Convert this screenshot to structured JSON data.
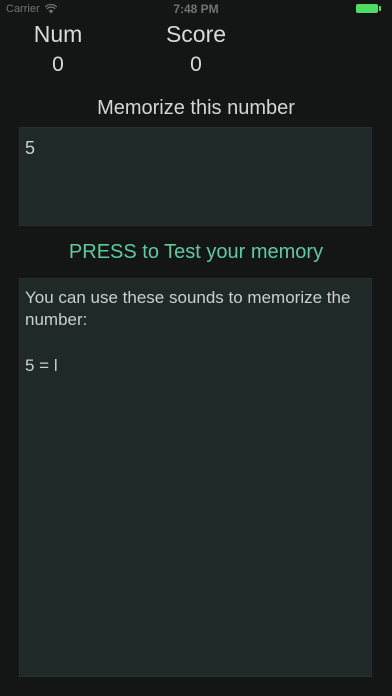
{
  "status_bar": {
    "carrier": "Carrier",
    "time": "7:48 PM",
    "battery_color": "#4fdc64"
  },
  "stats": {
    "num_label": "Num",
    "num_value": "0",
    "score_label": "Score",
    "score_value": "0"
  },
  "prompt": "Memorize this number",
  "number_display": "5",
  "test_button_label": "PRESS to Test your memory",
  "hint": {
    "intro": "You can use these sounds to memorize the number:",
    "mapping": "5 = l"
  },
  "colors": {
    "background": "#141616",
    "panel": "#1e2928",
    "accent": "#5fc9a2",
    "text": "#c9d0cf"
  }
}
